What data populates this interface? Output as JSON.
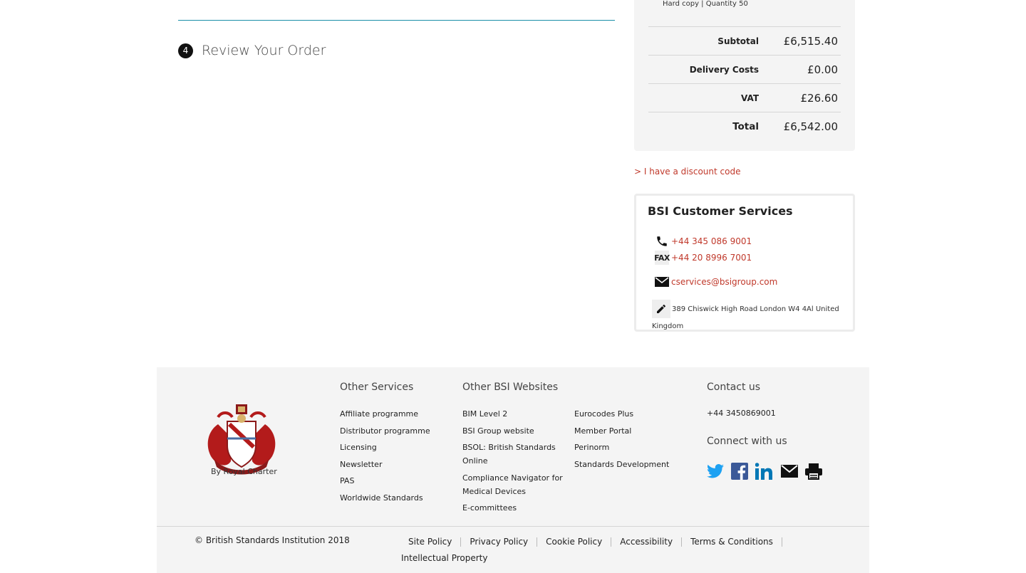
{
  "checkout": {
    "step_number": "4",
    "step_title": "Review Your Order"
  },
  "summary": {
    "item_detail": "Hard copy | Quantity 50",
    "rows": [
      {
        "label": "Subtotal",
        "value": "£6,515.40"
      },
      {
        "label": "Delivery Costs",
        "value": "£0.00"
      },
      {
        "label": "VAT",
        "value": "£26.60"
      },
      {
        "label": "Total",
        "value": "£6,542.00"
      }
    ]
  },
  "discount_link": "> I have a discount code",
  "customer_services": {
    "title": "BSI Customer Services",
    "phone": "+44 345 086 9001",
    "fax_label": "FAX",
    "fax": "+44 20 8996 7001",
    "email": "cservices@bsigroup.com",
    "address": "389 Chiswick High Road London W4 4Al United Kingdom"
  },
  "footer": {
    "charter": "By Royal Charter",
    "other_services": {
      "title": "Other Services",
      "items": [
        "Affiliate programme",
        "Distributor programme",
        "Licensing",
        "Newsletter",
        "PAS",
        "Worldwide Standards"
      ]
    },
    "other_websites": {
      "title": "Other BSI Websites",
      "col1": [
        "BIM Level 2",
        "BSI Group website",
        "BSOL: British Standards Online",
        "Compliance Navigator for Medical Devices",
        "E-committees"
      ],
      "col2": [
        "Eurocodes Plus",
        "Member Portal",
        "Perinorm",
        "Standards Development"
      ]
    },
    "contact": {
      "title": "Contact us",
      "phone": "+44 3450869001",
      "connect_title": "Connect with us"
    },
    "social_icons": [
      "twitter-icon",
      "facebook-icon",
      "linkedin-icon",
      "mail-icon",
      "print-icon"
    ],
    "copyright": "© British Standards Institution 2018",
    "policies": [
      "Site Policy",
      "Privacy Policy",
      "Cookie Policy",
      "Accessibility",
      "Terms & Conditions",
      "Intellectual Property"
    ]
  },
  "colors": {
    "accent_red": "#c0392b",
    "teal_divider": "#1a8fa8",
    "twitter": "#1da1f2",
    "facebook": "#3b5998",
    "linkedin": "#0077b5"
  }
}
